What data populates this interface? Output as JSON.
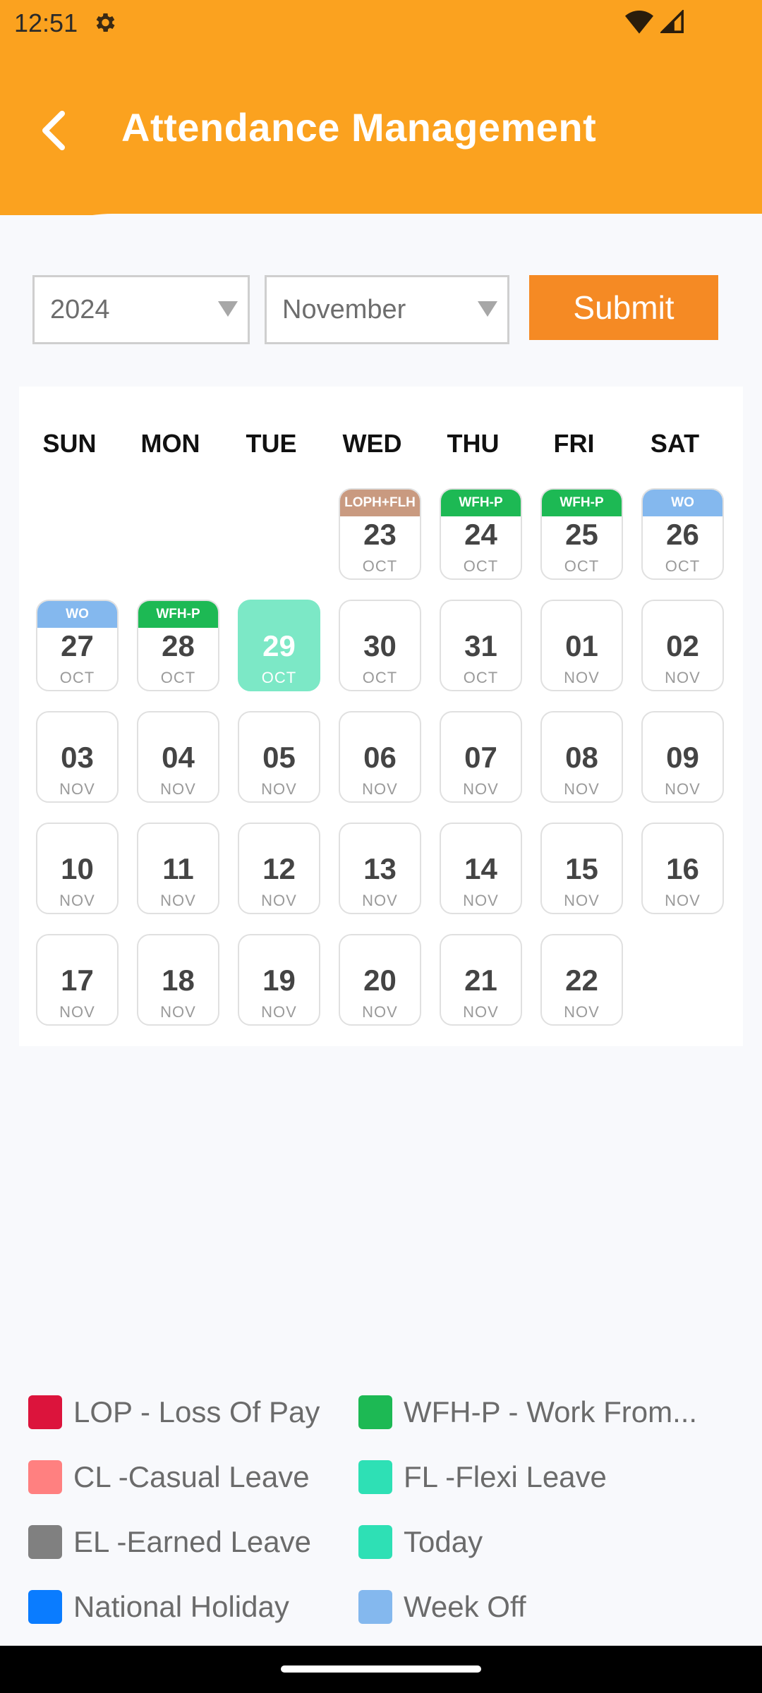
{
  "status": {
    "time": "12:51"
  },
  "header": {
    "title": "Attendance Management"
  },
  "controls": {
    "year": "2024",
    "month": "November",
    "submit_label": "Submit"
  },
  "calendar": {
    "weekdays": [
      "SUN",
      "MON",
      "TUE",
      "WED",
      "THU",
      "FRI",
      "SAT"
    ],
    "days": [
      {
        "num": "23",
        "mon": "OCT",
        "tag": "LOPH+FLH",
        "tagColor": "#C99A80"
      },
      {
        "num": "24",
        "mon": "OCT",
        "tag": "WFH-P",
        "tagColor": "#1DB954"
      },
      {
        "num": "25",
        "mon": "OCT",
        "tag": "WFH-P",
        "tagColor": "#1DB954"
      },
      {
        "num": "26",
        "mon": "OCT",
        "tag": "WO",
        "tagColor": "#84B8EE"
      },
      {
        "num": "27",
        "mon": "OCT",
        "tag": "WO",
        "tagColor": "#84B8EE"
      },
      {
        "num": "28",
        "mon": "OCT",
        "tag": "WFH-P",
        "tagColor": "#1DB954"
      },
      {
        "num": "29",
        "mon": "OCT",
        "tag": "",
        "today": true
      },
      {
        "num": "30",
        "mon": "OCT",
        "tag": ""
      },
      {
        "num": "31",
        "mon": "OCT",
        "tag": ""
      },
      {
        "num": "01",
        "mon": "NOV",
        "tag": ""
      },
      {
        "num": "02",
        "mon": "NOV",
        "tag": ""
      },
      {
        "num": "03",
        "mon": "NOV",
        "tag": ""
      },
      {
        "num": "04",
        "mon": "NOV",
        "tag": ""
      },
      {
        "num": "05",
        "mon": "NOV",
        "tag": ""
      },
      {
        "num": "06",
        "mon": "NOV",
        "tag": ""
      },
      {
        "num": "07",
        "mon": "NOV",
        "tag": ""
      },
      {
        "num": "08",
        "mon": "NOV",
        "tag": ""
      },
      {
        "num": "09",
        "mon": "NOV",
        "tag": ""
      },
      {
        "num": "10",
        "mon": "NOV",
        "tag": ""
      },
      {
        "num": "11",
        "mon": "NOV",
        "tag": ""
      },
      {
        "num": "12",
        "mon": "NOV",
        "tag": ""
      },
      {
        "num": "13",
        "mon": "NOV",
        "tag": ""
      },
      {
        "num": "14",
        "mon": "NOV",
        "tag": ""
      },
      {
        "num": "15",
        "mon": "NOV",
        "tag": ""
      },
      {
        "num": "16",
        "mon": "NOV",
        "tag": ""
      },
      {
        "num": "17",
        "mon": "NOV",
        "tag": ""
      },
      {
        "num": "18",
        "mon": "NOV",
        "tag": ""
      },
      {
        "num": "19",
        "mon": "NOV",
        "tag": ""
      },
      {
        "num": "20",
        "mon": "NOV",
        "tag": ""
      },
      {
        "num": "21",
        "mon": "NOV",
        "tag": ""
      },
      {
        "num": "22",
        "mon": "NOV",
        "tag": ""
      }
    ]
  },
  "legend": [
    {
      "label": "LOP - Loss Of Pay",
      "color": "#DC143C"
    },
    {
      "label": "WFH-P - Work From...",
      "color": "#1DB954"
    },
    {
      "label": "CL -Casual Leave",
      "color": "#FF8080"
    },
    {
      "label": "FL -Flexi Leave",
      "color": "#2EE0B5"
    },
    {
      "label": "EL -Earned Leave",
      "color": "#808080"
    },
    {
      "label": "Today",
      "color": "#2EE0B5"
    },
    {
      "label": "National Holiday",
      "color": "#0A7CFF"
    },
    {
      "label": "Week Off",
      "color": "#84B8EE"
    }
  ]
}
